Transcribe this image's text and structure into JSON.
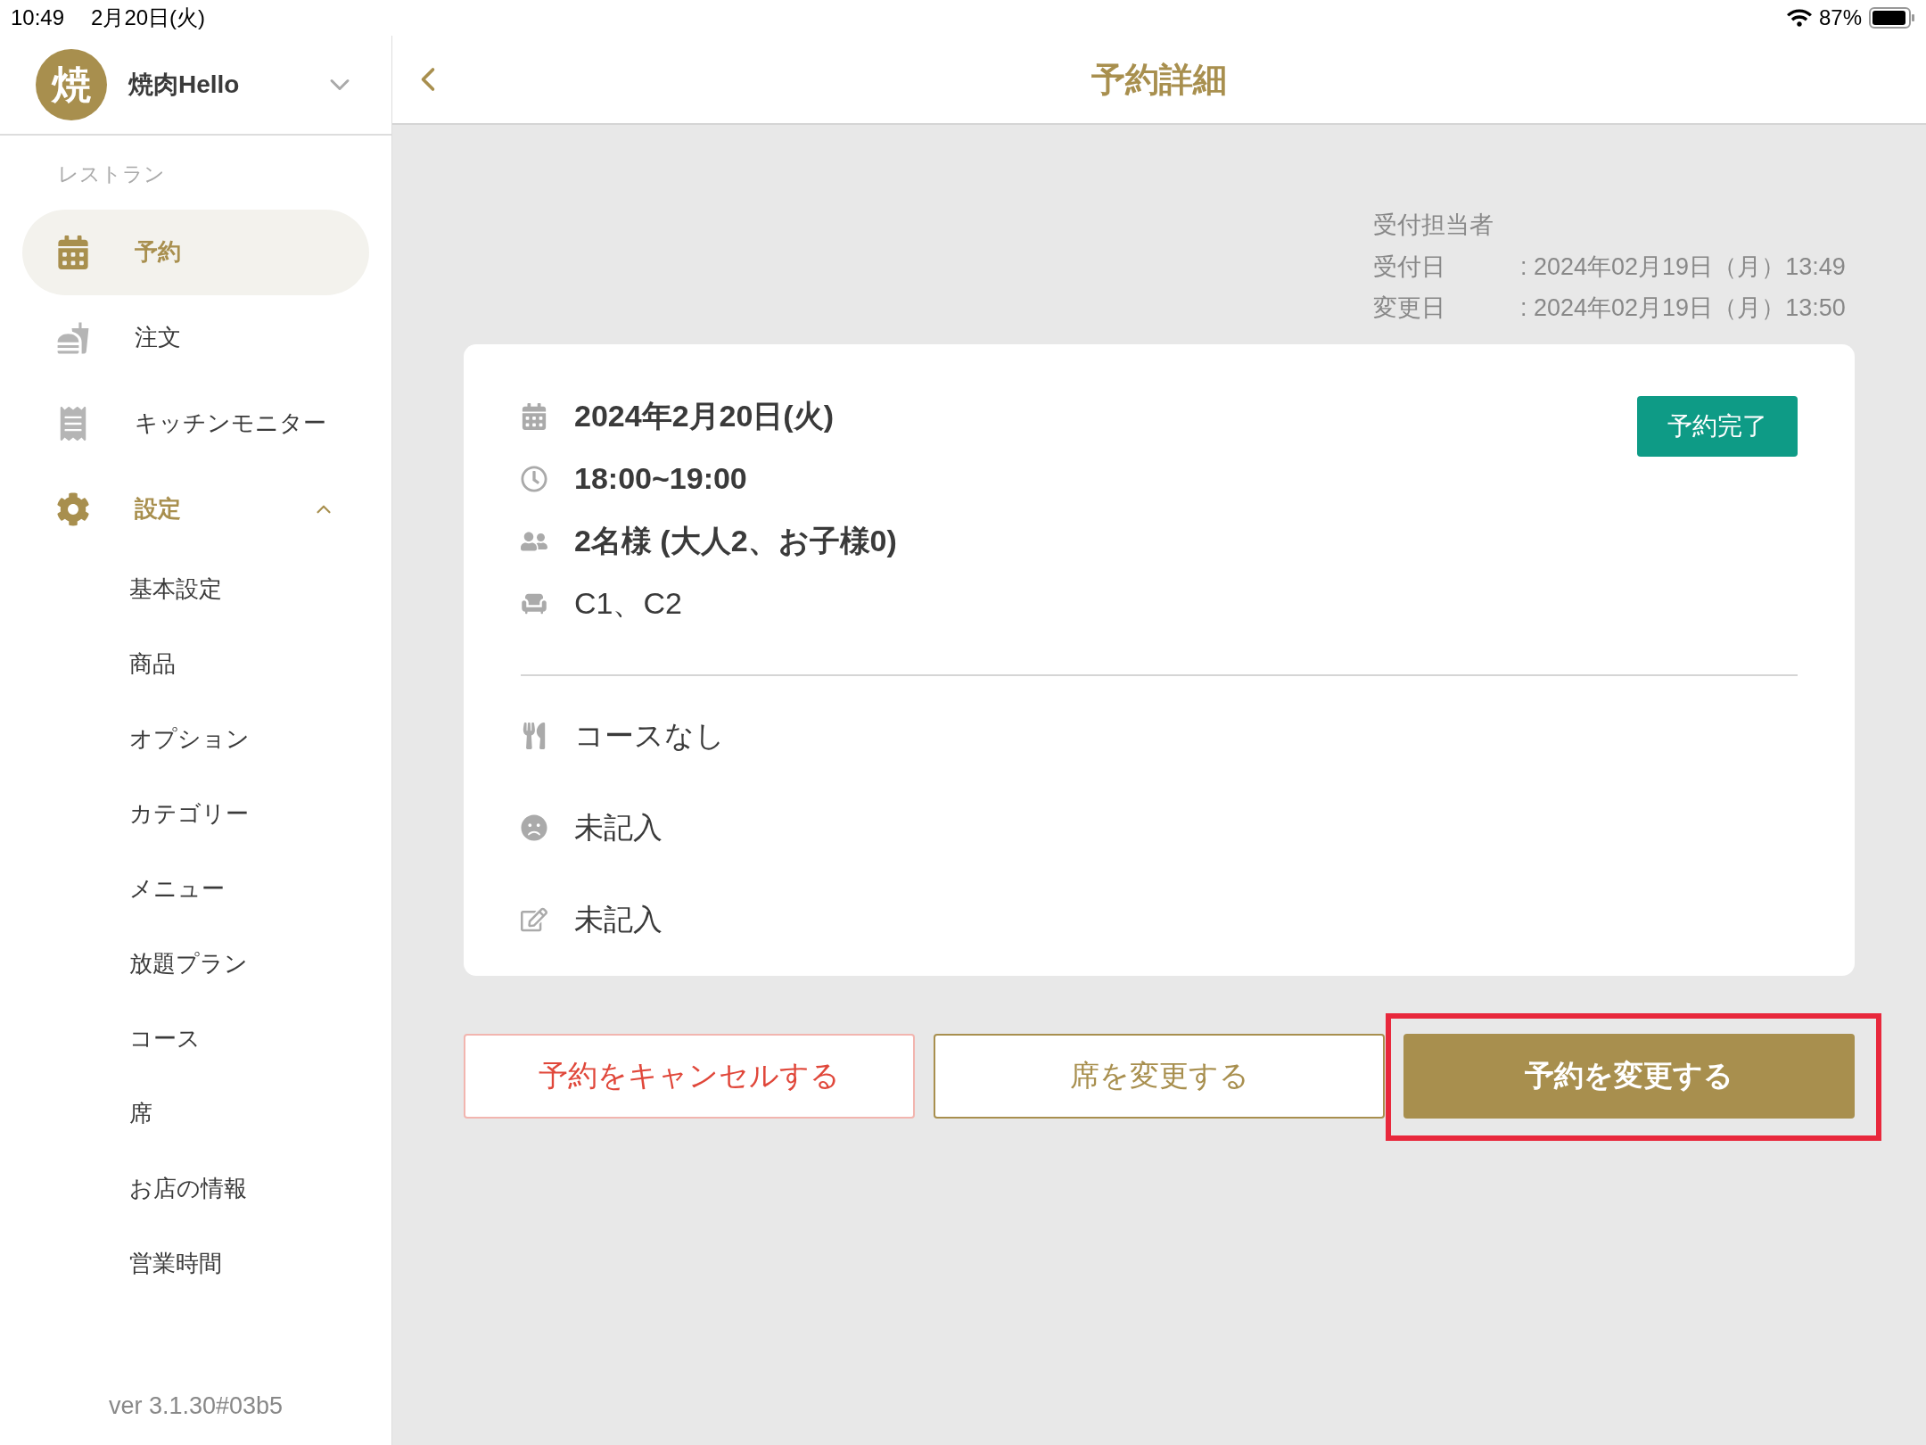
{
  "status_bar": {
    "time": "10:49",
    "date": "2月20日(火)",
    "battery": "87%"
  },
  "sidebar": {
    "store": {
      "avatar": "焼",
      "name": "焼肉Hello"
    },
    "section_label": "レストラン",
    "items": [
      {
        "label": "予約",
        "kind": "calendar",
        "selected": true
      },
      {
        "label": "注文",
        "kind": "food",
        "selected": false
      },
      {
        "label": "キッチンモニター",
        "kind": "receipt",
        "selected": false
      },
      {
        "label": "設定",
        "kind": "gear",
        "selected": false,
        "expanded": true,
        "children": [
          {
            "label": "基本設定",
            "selected": false
          },
          {
            "label": "商品",
            "selected": false
          },
          {
            "label": "オプション",
            "selected": false
          },
          {
            "label": "カテゴリー",
            "selected": false
          },
          {
            "label": "メニュー",
            "selected": false
          },
          {
            "label": "放題プラン",
            "selected": false
          },
          {
            "label": "コース",
            "selected": false
          },
          {
            "label": "席",
            "selected": false
          },
          {
            "label": "お店の情報",
            "selected": false
          },
          {
            "label": "営業時間",
            "selected": false
          }
        ]
      }
    ],
    "version": "ver 3.1.30#03b5"
  },
  "header": {
    "title": "予約詳細"
  },
  "meta": [
    {
      "label": "受付担当者"
    },
    {
      "label": "受付日",
      "value": ": 2024年02月19日（月）13:49"
    },
    {
      "label": "変更日",
      "value": ": 2024年02月19日（月）13:50"
    }
  ],
  "card": {
    "status": "予約完了",
    "details": [
      {
        "kind": "calendar",
        "text": "2024年2月20日(火)",
        "bold": true
      },
      {
        "kind": "clock",
        "text": "18:00~19:00",
        "bold": true
      },
      {
        "kind": "people",
        "text": "2名様 (大人2、お子様0)",
        "bold": true
      },
      {
        "kind": "chair",
        "text": "C1、C2",
        "bold": false
      }
    ],
    "notes": [
      {
        "kind": "utensils",
        "text": "コースなし"
      },
      {
        "kind": "frown",
        "text": "未記入"
      },
      {
        "kind": "edit",
        "text": "未記入"
      }
    ]
  },
  "buttons": [
    {
      "kind": "danger",
      "label": "予約をキャンセルする",
      "highlighted": false
    },
    {
      "kind": "outline",
      "label": "席を変更する",
      "highlighted": false
    },
    {
      "kind": "primary",
      "label": "予約を変更する",
      "highlighted": true
    }
  ]
}
